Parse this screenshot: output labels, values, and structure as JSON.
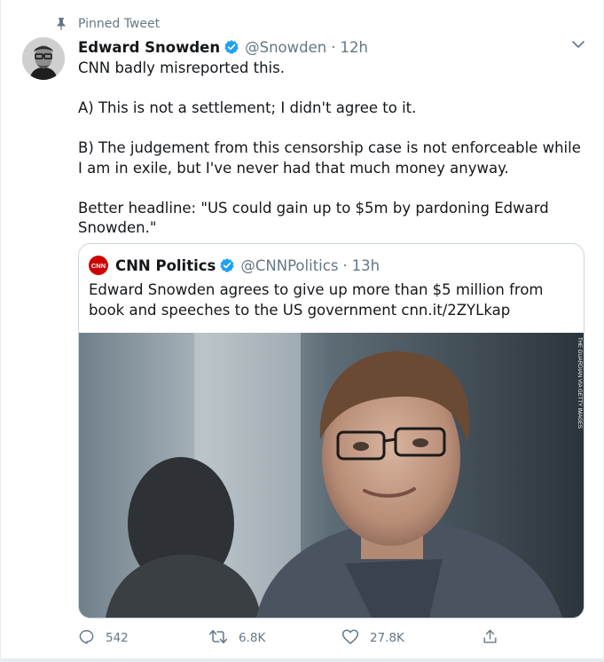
{
  "pinned": {
    "label": "Pinned Tweet"
  },
  "tweet": {
    "author_name": "Edward Snowden",
    "handle": "@Snowden",
    "separator": "·",
    "time": "12h",
    "text_paragraphs": [
      "CNN badly misreported this.",
      "A) This is not a settlement; I didn't agree to it.",
      "B) The judgement from this censorship case is not enforceable while I am in exile, but I've never had that much money anyway.",
      "Better headline: \"US could gain up to $5m by pardoning Edward Snowden.\""
    ]
  },
  "quoted_tweet": {
    "author_name": "CNN Politics",
    "handle": "@CNNPolitics",
    "separator": "·",
    "time": "13h",
    "logo_text": "CNN",
    "text": "Edward Snowden agrees to give up more than $5 million from book and speeches to the US government cnn.it/2ZYLkap",
    "image_credit": "THE GUARDIAN VIA GETTY IMAGES"
  },
  "actions": {
    "reply_count": "542",
    "retweet_count": "6.8K",
    "like_count": "27.8K"
  },
  "icons": {
    "pin": "pin-icon",
    "verified": "verified-badge-icon",
    "chevron": "chevron-down-icon",
    "reply": "reply-icon",
    "retweet": "retweet-icon",
    "like": "heart-icon",
    "share": "share-icon"
  },
  "colors": {
    "accent": "#1da1f2",
    "muted_text": "#657786",
    "cnn_red": "#cc0000",
    "border": "#ccd6dd"
  }
}
